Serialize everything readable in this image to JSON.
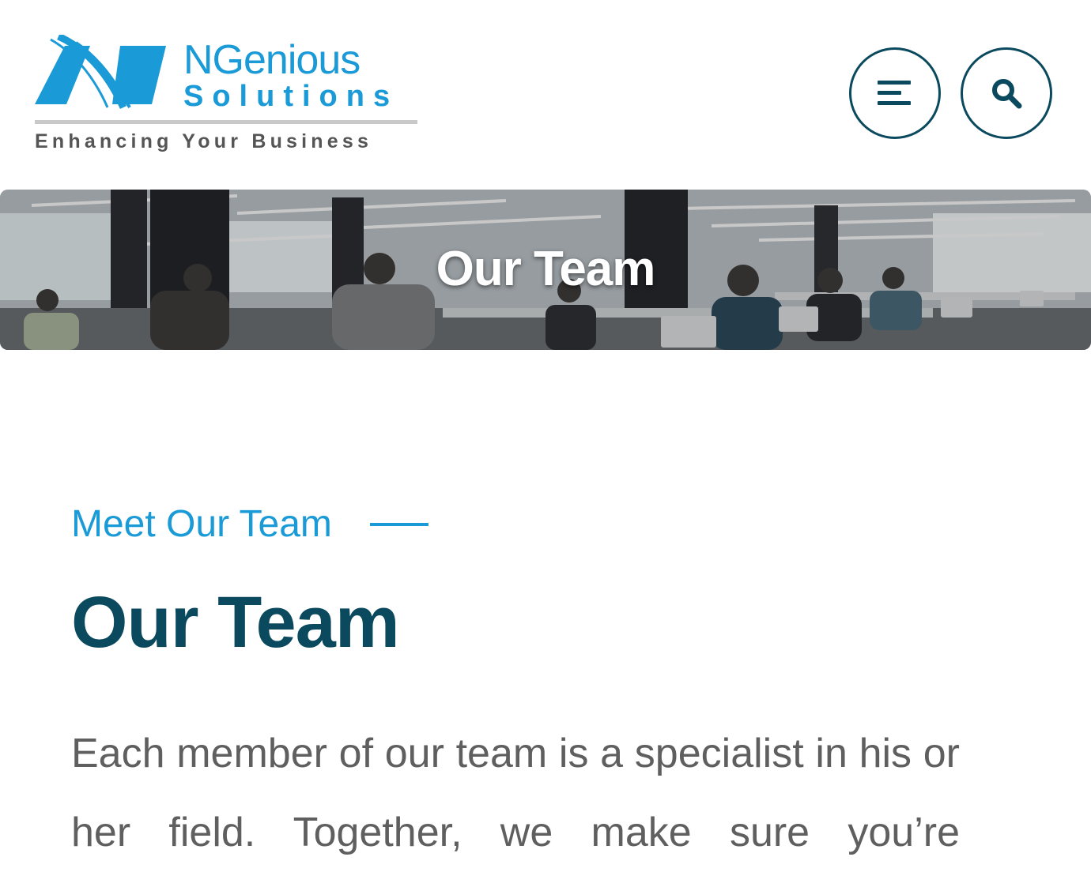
{
  "header": {
    "logo": {
      "name": "NGenious",
      "sub": "Solutions",
      "tagline": "Enhancing Your Business"
    },
    "menu_icon": "menu-icon",
    "search_icon": "search-icon"
  },
  "hero": {
    "title": "Our Team"
  },
  "section": {
    "eyebrow": "Meet Our Team",
    "heading": "Our Team",
    "body": "Each member of our team is a specialist in his or her field. Together, we make sure you’re"
  },
  "colors": {
    "brand_blue": "#1a9ad6",
    "dark_teal": "#0b4a5e",
    "body_gray": "#5f5f5f"
  }
}
